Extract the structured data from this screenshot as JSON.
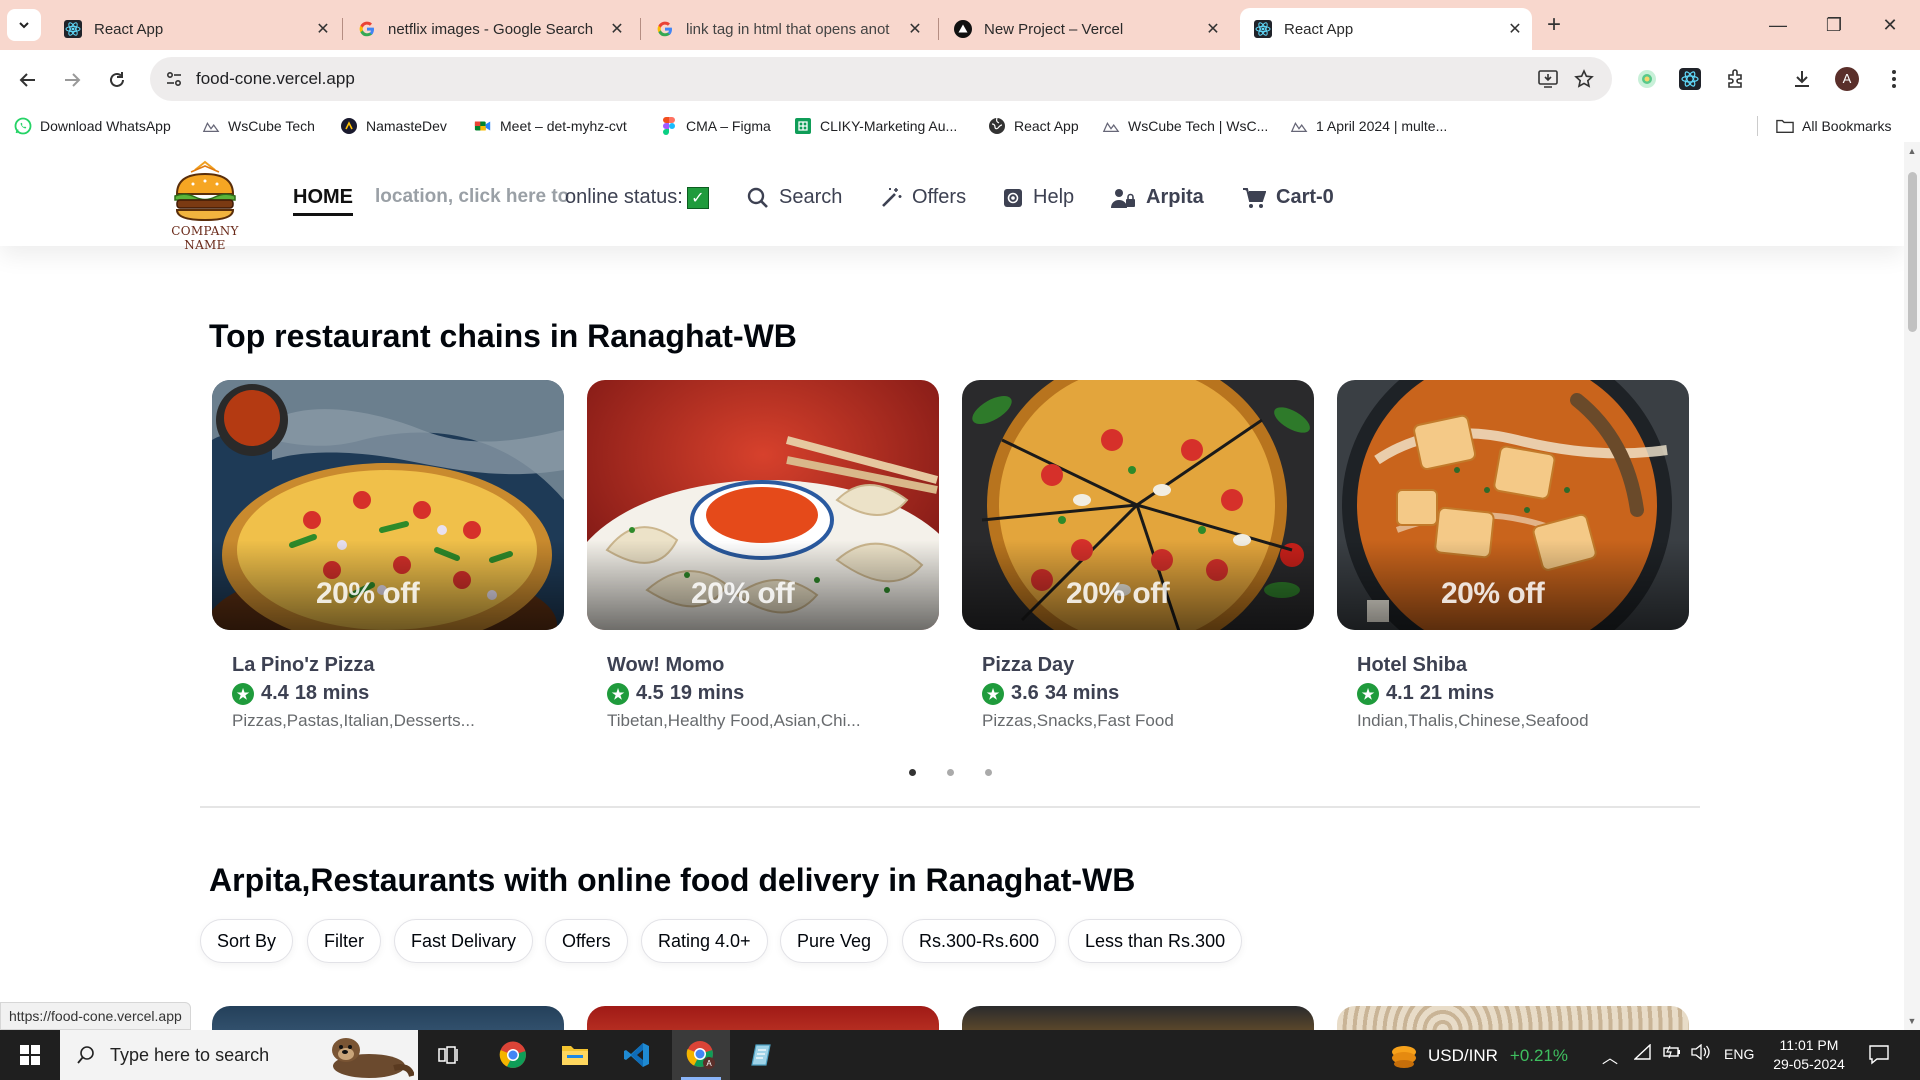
{
  "browser": {
    "tabs": [
      {
        "title": "React App",
        "favicon": "react-icon",
        "active": false
      },
      {
        "title": "netflix images - Google Search",
        "favicon": "google-icon",
        "active": false
      },
      {
        "title": "link tag in html that opens anot",
        "favicon": "google-icon",
        "active": false
      },
      {
        "title": "New Project – Vercel",
        "favicon": "vercel-icon",
        "active": false
      },
      {
        "title": "React App",
        "favicon": "react-icon",
        "active": true
      }
    ],
    "url": "food-cone.vercel.app",
    "bookmarks": [
      {
        "label": "Download WhatsApp",
        "icon": "whatsapp-icon"
      },
      {
        "label": "WsCube Tech",
        "icon": "wscube-icon"
      },
      {
        "label": "NamasteDev",
        "icon": "namastedev-icon"
      },
      {
        "label": "Meet – det-myhz-cvt",
        "icon": "meet-icon"
      },
      {
        "label": "CMA – Figma",
        "icon": "figma-icon"
      },
      {
        "label": "CLIKY-Marketing Au...",
        "icon": "sheets-icon"
      },
      {
        "label": "React App",
        "icon": "globe-icon"
      },
      {
        "label": "WsCube Tech | WsC...",
        "icon": "wscube-icon"
      },
      {
        "label": "1 April 2024 | multe...",
        "icon": "wscube-icon"
      }
    ],
    "all_bookmarks": "All Bookmarks",
    "profile_initial": "A",
    "status_url": "https://food-cone.vercel.app"
  },
  "site": {
    "brand": "COMPANY NAME",
    "nav": {
      "home": "HOME",
      "location": "location, click here to",
      "status": "online status:",
      "search": "Search",
      "offers": "Offers",
      "help": "Help",
      "user": "Arpita",
      "cart": "Cart-0"
    },
    "top_chains": {
      "title": "Top restaurant chains in Ranaghat-WB",
      "cards": [
        {
          "name": "La Pino'z Pizza",
          "rating": "4.4",
          "time": "18 mins",
          "cuisines": "Pizzas,Pastas,Italian,Desserts...",
          "offer": "20% off"
        },
        {
          "name": "Wow! Momo",
          "rating": "4.5",
          "time": "19 mins",
          "cuisines": "Tibetan,Healthy Food,Asian,Chi...",
          "offer": "20% off"
        },
        {
          "name": "Pizza Day",
          "rating": "3.6",
          "time": "34 mins",
          "cuisines": "Pizzas,Snacks,Fast Food",
          "offer": "20% off"
        },
        {
          "name": "Hotel Shiba",
          "rating": "4.1",
          "time": "21 mins",
          "cuisines": "Indian,Thalis,Chinese,Seafood",
          "offer": "20% off"
        }
      ]
    },
    "online_delivery": {
      "title": "Arpita,Restaurants with online food delivery in Ranaghat-WB",
      "filters": [
        "Sort By",
        "Filter",
        "Fast Delivary",
        "Offers",
        "Rating 4.0+",
        "Pure Veg",
        "Rs.300-Rs.600",
        "Less than Rs.300"
      ]
    }
  },
  "taskbar": {
    "search_placeholder": "Type here to search",
    "ticker_label": "USD/INR",
    "ticker_change": "+0.21%",
    "language": "ENG",
    "time": "11:01 PM",
    "date": "29-05-2024"
  },
  "colors": {
    "tabbar": "#f8d7cd",
    "rating_green": "#1f9b3c",
    "taskbar": "#1f1f1f"
  }
}
